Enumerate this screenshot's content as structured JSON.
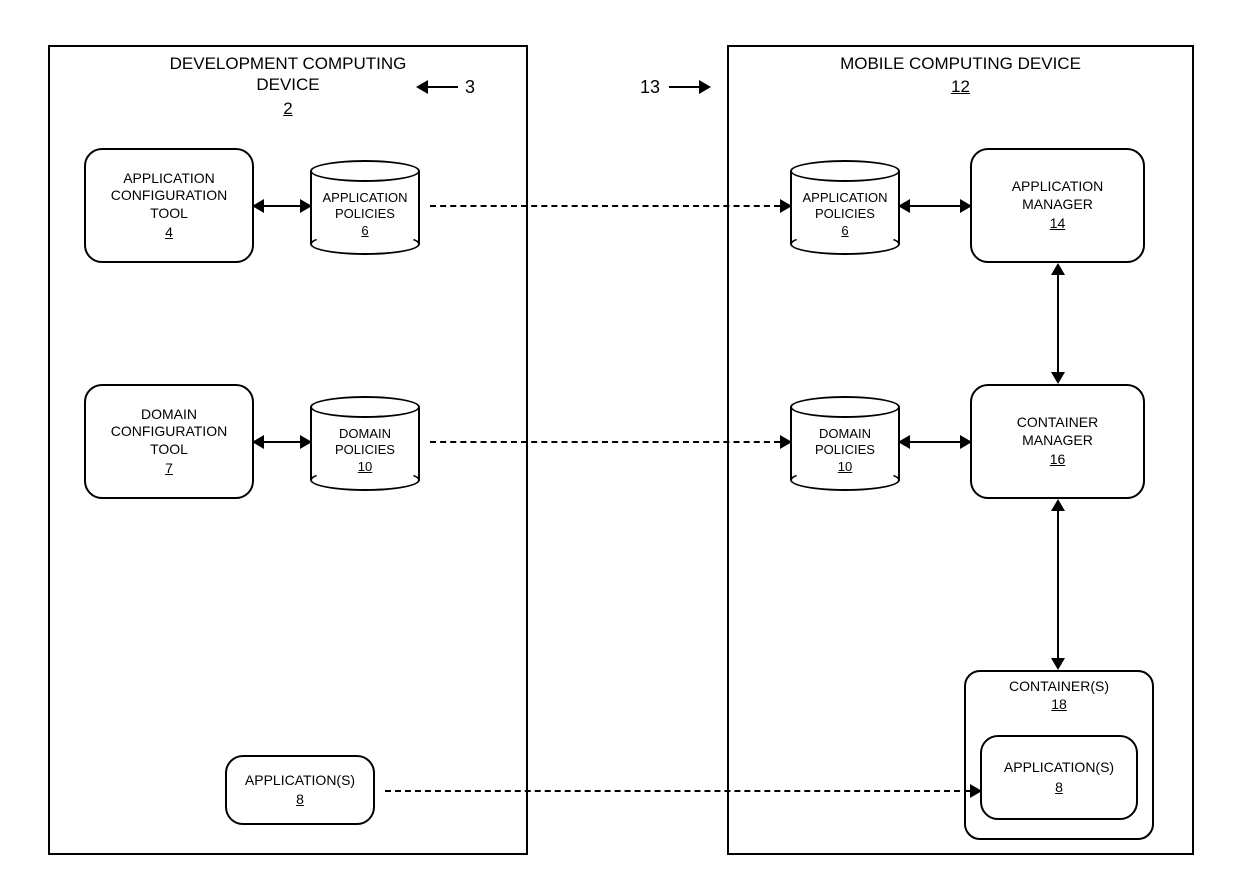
{
  "dev": {
    "title_line1": "DEVELOPMENT COMPUTING",
    "title_line2": "DEVICE",
    "num": "2",
    "callout_num": "3",
    "app_config_tool": {
      "label_line1": "APPLICATION",
      "label_line2": "CONFIGURATION",
      "label_line3": "TOOL",
      "num": "4"
    },
    "app_policies": {
      "label_line1": "APPLICATION",
      "label_line2": "POLICIES",
      "num": "6"
    },
    "domain_config_tool": {
      "label_line1": "DOMAIN",
      "label_line2": "CONFIGURATION",
      "label_line3": "TOOL",
      "num": "7"
    },
    "domain_policies": {
      "label_line1": "DOMAIN",
      "label_line2": "POLICIES",
      "num": "10"
    },
    "applications": {
      "label": "APPLICATION(S)",
      "num": "8"
    }
  },
  "mobile": {
    "title": "MOBILE COMPUTING DEVICE",
    "num": "12",
    "callout_num": "13",
    "app_policies": {
      "label_line1": "APPLICATION",
      "label_line2": "POLICIES",
      "num": "6"
    },
    "domain_policies": {
      "label_line1": "DOMAIN",
      "label_line2": "POLICIES",
      "num": "10"
    },
    "app_manager": {
      "label_line1": "APPLICATION",
      "label_line2": "MANAGER",
      "num": "14"
    },
    "container_manager": {
      "label_line1": "CONTAINER",
      "label_line2": "MANAGER",
      "num": "16"
    },
    "containers": {
      "label": "CONTAINER(S)",
      "num": "18",
      "app": {
        "label": "APPLICATION(S)",
        "num": "8"
      }
    }
  }
}
